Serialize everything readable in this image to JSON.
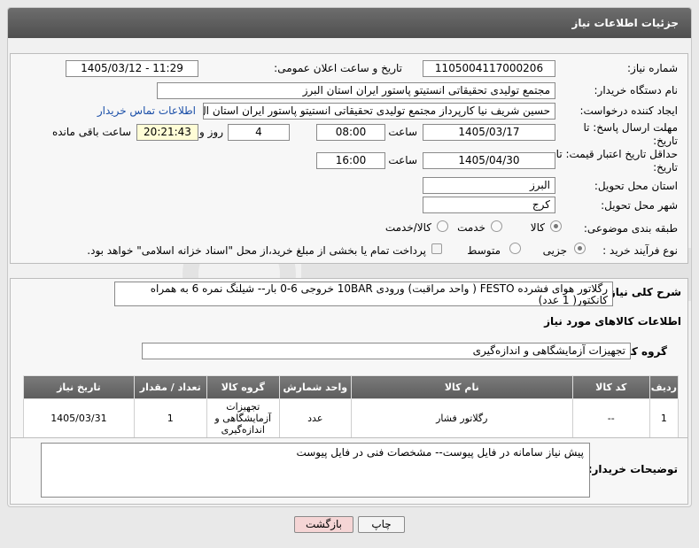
{
  "header": {
    "title": "جزئیات اطلاعات نیاز"
  },
  "form": {
    "need_number_label": "شماره نیاز:",
    "need_number": "1105004117000206",
    "announce_label": "تاریخ و ساعت اعلان عمومی:",
    "announce_value": "1405/03/12 - 11:29",
    "buyer_org_label": "نام دستگاه خریدار:",
    "buyer_org": "مجتمع تولیدی تحقیقاتی انستیتو پاستور ایران استان البرز",
    "requester_label": "ایجاد کننده درخواست:",
    "requester": "حسین شریف نیا کارپرداز مجتمع تولیدی تحقیقاتی انستیتو پاستور ایران استان ال",
    "contact_link": "اطلاعات تماس خریدار",
    "deadline_label": "مهلت ارسال پاسخ: تا تاریخ:",
    "deadline_date": "1405/03/17",
    "time_label": "ساعت",
    "deadline_time": "08:00",
    "days_value": "4",
    "days_label": "روز و",
    "remaining_time": "20:21:43",
    "remaining_label": "ساعت باقی مانده",
    "validity_label": "حداقل تاریخ اعتبار قیمت: تا تاریخ:",
    "validity_date": "1405/04/30",
    "validity_time_label": "ساعت",
    "validity_time": "16:00",
    "province_label": "استان محل تحویل:",
    "province": "البرز",
    "city_label": "شهر محل تحویل:",
    "city": "کرج",
    "category_label": "طبقه بندی موضوعی:",
    "category_options": [
      "کالا",
      "خدمت",
      "کالا/خدمت"
    ],
    "process_label": "نوع فرآیند خرید :",
    "process_options": [
      "جزیی",
      "متوسط"
    ],
    "payment_note": "پرداخت تمام یا بخشی از مبلغ خرید،از محل \"اسناد خزانه اسلامی\" خواهد بود."
  },
  "summary": {
    "label": "شرح کلی نیاز:",
    "text": "رگلاتور هوای فشرده FESTO ( واحد مراقبت) ورودی 10BAR خروجی 6-0 بار-- شیلنگ نمره 6 به همراه کانکتور( 1 عدد)"
  },
  "goods": {
    "section_title": "اطلاعات کالاهای مورد نیاز",
    "group_label": "گروه کالا:",
    "group_value": "تجهیزات آزمایشگاهی و اندازه‌گیری",
    "columns": [
      "ردیف",
      "کد کالا",
      "نام کالا",
      "واحد شمارش",
      "گروه کالا",
      "تعداد / مقدار",
      "تاریخ نیاز"
    ],
    "rows": [
      {
        "row": "1",
        "code": "--",
        "name": "رگلاتور فشار",
        "unit": "عدد",
        "group": "تجهیزات آزمایشگاهی و اندازه‌گیری",
        "qty": "1",
        "date": "1405/03/31"
      }
    ]
  },
  "notes": {
    "label": "توضیحات خریدار:",
    "text": "پیش نیاز سامانه در فایل پیوست-- مشخصات فنی در فایل پیوست"
  },
  "buttons": {
    "print": "چاپ",
    "back": "بازگشت"
  },
  "colors": {
    "header": "#5c5c5c",
    "link": "#1b4fa8",
    "back_button": "#f5d5d5"
  }
}
